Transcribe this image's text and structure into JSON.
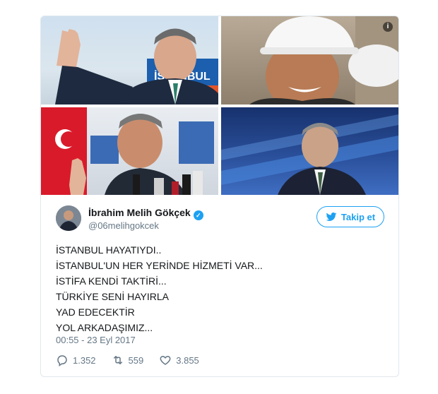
{
  "tweet": {
    "display_name": "İbrahim Melih Gökçek",
    "handle": "@06melihgokcek",
    "follow_label": "Takip et",
    "text_lines": [
      "İSTANBUL HAYATIYDI..",
      "İSTANBUL'UN HER YERİNDE HİZMETİ VAR...",
      "İSTİFA KENDİ TAKTİRİ...",
      "TÜRKİYE SENİ HAYIRLA",
      "YAD EDECEKTİR",
      "YOL ARKADAŞIMIZ..."
    ],
    "timestamp": "00:55 - 23 Eyl 2017",
    "replies": "1.352",
    "retweets": "559",
    "likes": "3.855"
  },
  "media": {
    "photo1_sign": "İSTANBUL",
    "info_glyph": "i"
  },
  "colors": {
    "accent": "#1da1f2",
    "text": "#14171a",
    "muted": "#657786",
    "border": "#e1e8ed"
  },
  "icons": [
    "info-icon",
    "verified-icon",
    "twitter-bird-icon",
    "reply-icon",
    "retweet-icon",
    "heart-icon"
  ]
}
